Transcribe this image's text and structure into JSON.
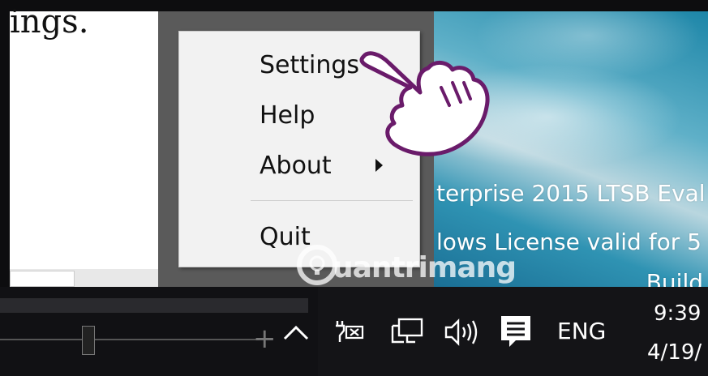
{
  "document": {
    "partial_text": "ings."
  },
  "context_menu": {
    "items": [
      {
        "label": "Settings"
      },
      {
        "label": "Help"
      },
      {
        "label": "About",
        "has_submenu": true
      },
      {
        "label": "Quit"
      }
    ]
  },
  "desktop": {
    "watermark_line1": "terprise 2015 LTSB Eval",
    "watermark_line2": "lows License valid for 5",
    "watermark_line3": "Build"
  },
  "site_watermark": {
    "text": "uantrimang"
  },
  "taskbar": {
    "language": "ENG",
    "time": "9:39",
    "date": "4/19/",
    "icons": [
      "chevron-up-icon",
      "battery-charging-icon",
      "network-icon",
      "volume-icon",
      "action-center-icon"
    ]
  },
  "colors": {
    "menu_bg": "#f2f2f2",
    "taskbar_bg": "#141417",
    "desktop_accent": "#1d86a8",
    "hand_outline": "#6a1b6a"
  }
}
